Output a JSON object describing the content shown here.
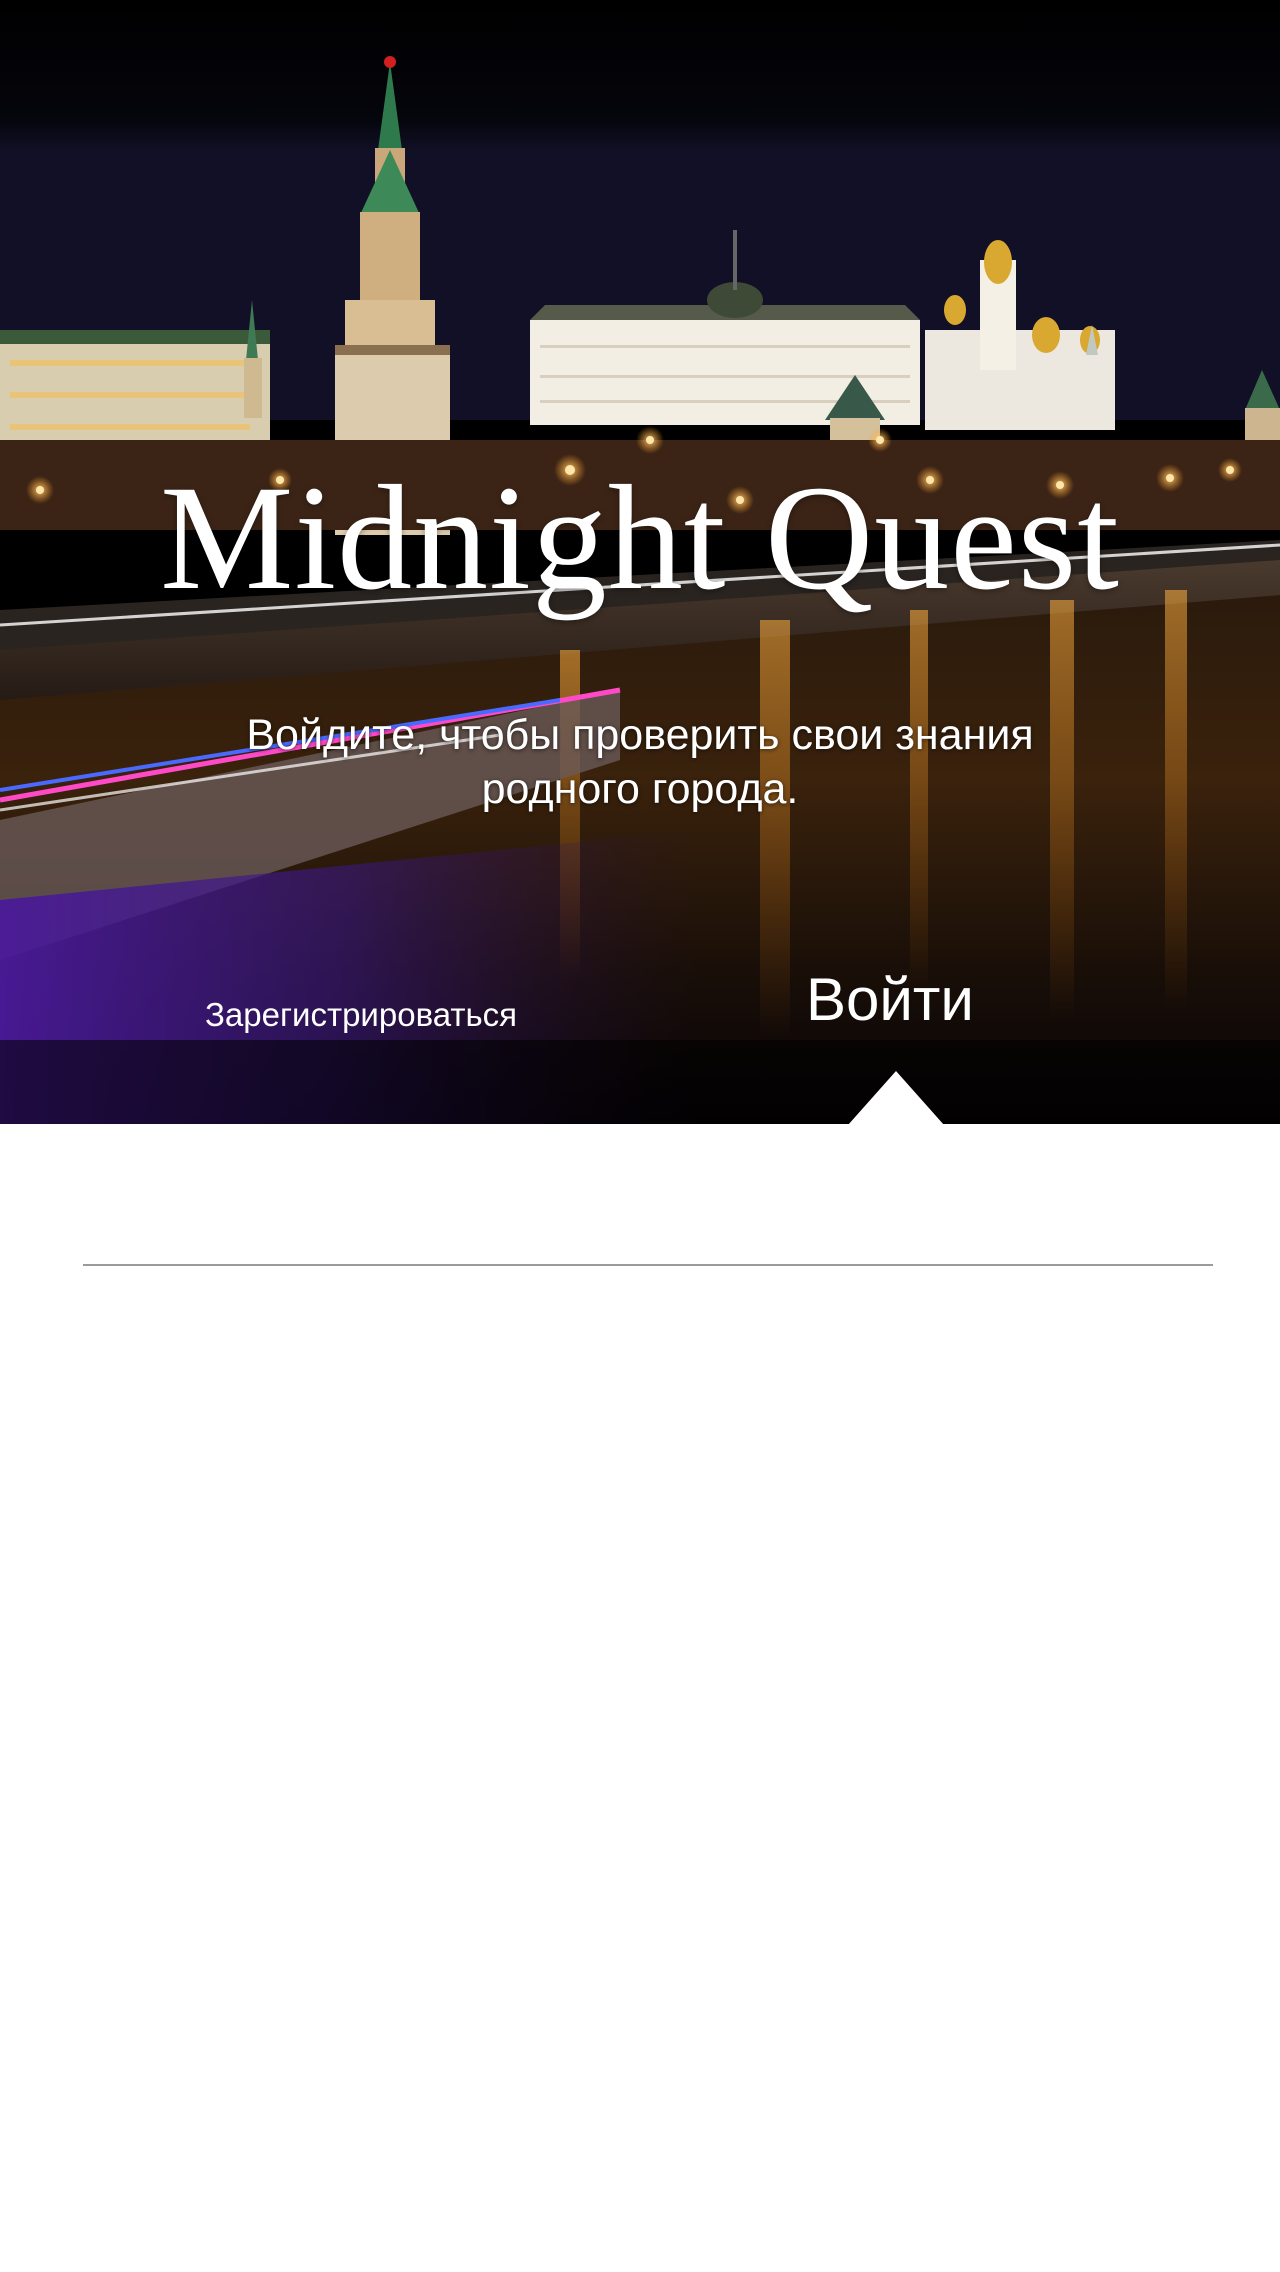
{
  "app": {
    "title": "Midnight Quest",
    "subtitle": "Войдите, чтобы проверить свои знания родного города."
  },
  "tabs": {
    "register_label": "Зарегистрироваться",
    "login_label": "Войти",
    "active": "login"
  },
  "colors": {
    "hero_text": "#ffffff",
    "page_background": "#ffffff",
    "divider": "#9a9a9a"
  }
}
